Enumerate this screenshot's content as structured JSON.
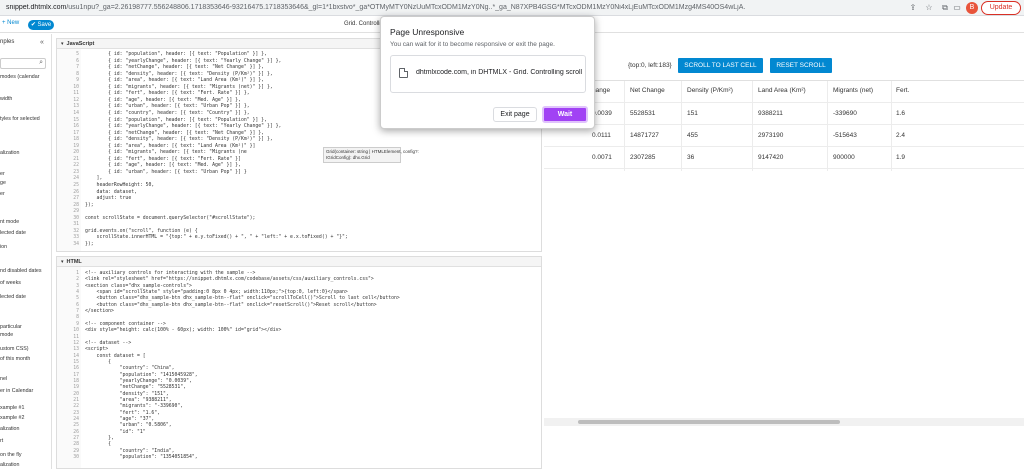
{
  "browser": {
    "host": "snippet.dhtmlx.com",
    "url_rest": "/usu1npu?_ga=2.26198777.556248806.1718353646-93216475.1718353646&_gl=1*1bxstvo*_ga*OTMyMTY0NzUuMTcxODM1MzY0Ng..*_ga_N87XPB4GSG*MTcxODM1MzY0Ni4xLjEuMTcxODM1Mzg4MS40OS4wLjA.",
    "avatar_letter": "B",
    "update_label": "Update"
  },
  "toolbar": {
    "new_label": "+ New",
    "save_label": "✔ Save",
    "page_title": "Grid. Controlling"
  },
  "sidebar": {
    "heading": "nples",
    "items": [
      "modes (calendar",
      "width",
      "tyles for selected",
      "alization",
      "er",
      "ge",
      "er",
      "nt mode",
      "lected date",
      "ion",
      "nd disabled dates",
      "of weeks",
      "lected date",
      "particular",
      "mode",
      "ustom CSS)",
      "of this month",
      "nel",
      "er in Calendar",
      "xample #1",
      "xample #2",
      "alization",
      "rt",
      "on the fly",
      "alization"
    ]
  },
  "js_panel": {
    "title": "JavaScript",
    "lines": [
      {
        "n": "5",
        "t": "        { id: \"population\", header: [{ text: \"Population\" }] },"
      },
      {
        "n": "6",
        "t": "        { id: \"yearlyChange\", header: [{ text: \"Yearly Change\" }] },"
      },
      {
        "n": "7",
        "t": "        { id: \"netChange\", header: [{ text: \"Net Change\" }] },"
      },
      {
        "n": "8",
        "t": "        { id: \"density\", header: [{ text: \"Density (P/Km²)\" }] },"
      },
      {
        "n": "9",
        "t": "        { id: \"area\", header: [{ text: \"Land Area (Km²)\" }] },"
      },
      {
        "n": "10",
        "t": "        { id: \"migrants\", header: [{ text: \"Migrants (net)\" }] },"
      },
      {
        "n": "11",
        "t": "        { id: \"fert\", header: [{ text: \"Fert. Rate\" }] },"
      },
      {
        "n": "12",
        "t": "        { id: \"age\", header: [{ text: \"Med. Age\" }] },"
      },
      {
        "n": "13",
        "t": "        { id: \"urban\", header: [{ text: \"Urban Pop\" }] },"
      },
      {
        "n": "14",
        "t": "        { id: \"country\", header: [{ text: \"Country\" }] },"
      },
      {
        "n": "15",
        "t": "        { id: \"population\", header: [{ text: \"Population\" }] },"
      },
      {
        "n": "16",
        "t": "        { id: \"yearlyChange\", header: [{ text: \"Yearly Change\" }] },"
      },
      {
        "n": "17",
        "t": "        { id: \"netChange\", header: [{ text: \"Net Change\" }] },"
      },
      {
        "n": "18",
        "t": "        { id: \"density\", header: [{ text: \"Density (P/Km²)\" }] },"
      },
      {
        "n": "19",
        "t": "        { id: \"area\", header: [{ text: \"Land Area (Km²)\" }]"
      },
      {
        "n": "20",
        "t": "        { id: \"migrants\", header: [{ text: \"Migrants (ne"
      },
      {
        "n": "21",
        "t": "        { id: \"fert\", header: [{ text: \"Fert. Rate\" }]"
      },
      {
        "n": "22",
        "t": "        { id: \"age\", header: [{ text: \"Med. Age\" }] },"
      },
      {
        "n": "23",
        "t": "        { id: \"urban\", header: [{ text: \"Urban Pop\" }] }"
      },
      {
        "n": "24",
        "t": "    ],"
      },
      {
        "n": "25",
        "t": "    headerRowHeight: 50,"
      },
      {
        "n": "26",
        "t": "    data: dataset,"
      },
      {
        "n": "27",
        "t": "    adjust: true"
      },
      {
        "n": "28",
        "t": "});"
      },
      {
        "n": "29",
        "t": ""
      },
      {
        "n": "30",
        "t": "const scrollState = document.querySelector(\"#scrollState\");"
      },
      {
        "n": "31",
        "t": ""
      },
      {
        "n": "32",
        "t": "grid.events.on(\"scroll\", function (e) {"
      },
      {
        "n": "33",
        "t": "    scrollState.innerHTML = \"{top:\" + e.y.toFixed() + \", \" + \"left:\" + e.x.toFixed() + \"}\";"
      },
      {
        "n": "34",
        "t": "});"
      }
    ],
    "tooltip": "Grid(container: string | HTMLElement, config?:\nIGridConfig): dhx.Grid"
  },
  "html_panel": {
    "title": "HTML",
    "lines": [
      {
        "n": "1",
        "t": "<!-- auxiliary controls for interacting with the sample -->"
      },
      {
        "n": "2",
        "t": "<link rel=\"stylesheet\" href=\"https://snippet.dhtmlx.com/codebase/assets/css/auxiliary_controls.css\">"
      },
      {
        "n": "3",
        "t": "<section class=\"dhx_sample-controls\">"
      },
      {
        "n": "4",
        "t": "    <span id=\"scrollState\" style=\"padding:0 8px 0 4px; width:110px;\">{top:0, left:0}</span>"
      },
      {
        "n": "5",
        "t": "    <button class=\"dhx_sample-btn dhx_sample-btn--flat\" onclick=\"scrollToCell()\">Scroll to last cell</button>"
      },
      {
        "n": "6",
        "t": "    <button class=\"dhx_sample-btn dhx_sample-btn--flat\" onclick=\"resetScroll()\">Reset scroll</button>"
      },
      {
        "n": "7",
        "t": "</section>"
      },
      {
        "n": "8",
        "t": ""
      },
      {
        "n": "9",
        "t": "<!-- component container -->"
      },
      {
        "n": "10",
        "t": "<div style=\"height: calc(100% - 60px); width: 100%\" id=\"grid\"></div>"
      },
      {
        "n": "11",
        "t": ""
      },
      {
        "n": "12",
        "t": "<!-- dataset -->"
      },
      {
        "n": "13",
        "t": "<script>"
      },
      {
        "n": "14",
        "t": "    const dataset = ["
      },
      {
        "n": "15",
        "t": "        {"
      },
      {
        "n": "16",
        "t": "            \"country\": \"China\","
      },
      {
        "n": "17",
        "t": "            \"population\": \"1415045928\","
      },
      {
        "n": "18",
        "t": "            \"yearlyChange\": \"0.0039\","
      },
      {
        "n": "19",
        "t": "            \"netChange\": \"5528531\","
      },
      {
        "n": "20",
        "t": "            \"density\": \"151\","
      },
      {
        "n": "21",
        "t": "            \"area\": \"9388211\","
      },
      {
        "n": "22",
        "t": "            \"migrants\": \"-339690\","
      },
      {
        "n": "23",
        "t": "            \"fert\": \"1.6\","
      },
      {
        "n": "24",
        "t": "            \"age\": \"37\","
      },
      {
        "n": "25",
        "t": "            \"urban\": \"0.5806\","
      },
      {
        "n": "26",
        "t": "            \"id\": \"1\""
      },
      {
        "n": "27",
        "t": "        },"
      },
      {
        "n": "28",
        "t": "        {"
      },
      {
        "n": "29",
        "t": "            \"country\": \"India\","
      },
      {
        "n": "30",
        "t": "            \"population\": \"1354051854\","
      }
    ]
  },
  "preview": {
    "scroll_state": "{top:0, left:183}",
    "scroll_last_label": "SCROLL TO LAST CELL",
    "reset_label": "RESET SCROLL",
    "headers": [
      "hange",
      "Net Change",
      "Density (P/Km²)",
      "Land Area (Km²)",
      "Migrants (net)",
      "Fert."
    ],
    "rows": [
      [
        "0.0039",
        "5528531",
        "151",
        "9388211",
        "-339690",
        "1.6"
      ],
      [
        "0.0111",
        "14871727",
        "455",
        "2973190",
        "-515643",
        "2.4"
      ],
      [
        "0.0071",
        "2307285",
        "36",
        "9147420",
        "900000",
        "1.9"
      ]
    ]
  },
  "dialog": {
    "title": "Page Unresponsive",
    "message": "You can wait for it to become responsive or exit the page.",
    "tab_label": "dhtmlxcode.com, in DHTMLX - Grid. Controlling scroll",
    "exit_label": "Exit page",
    "wait_label": "Wait"
  }
}
